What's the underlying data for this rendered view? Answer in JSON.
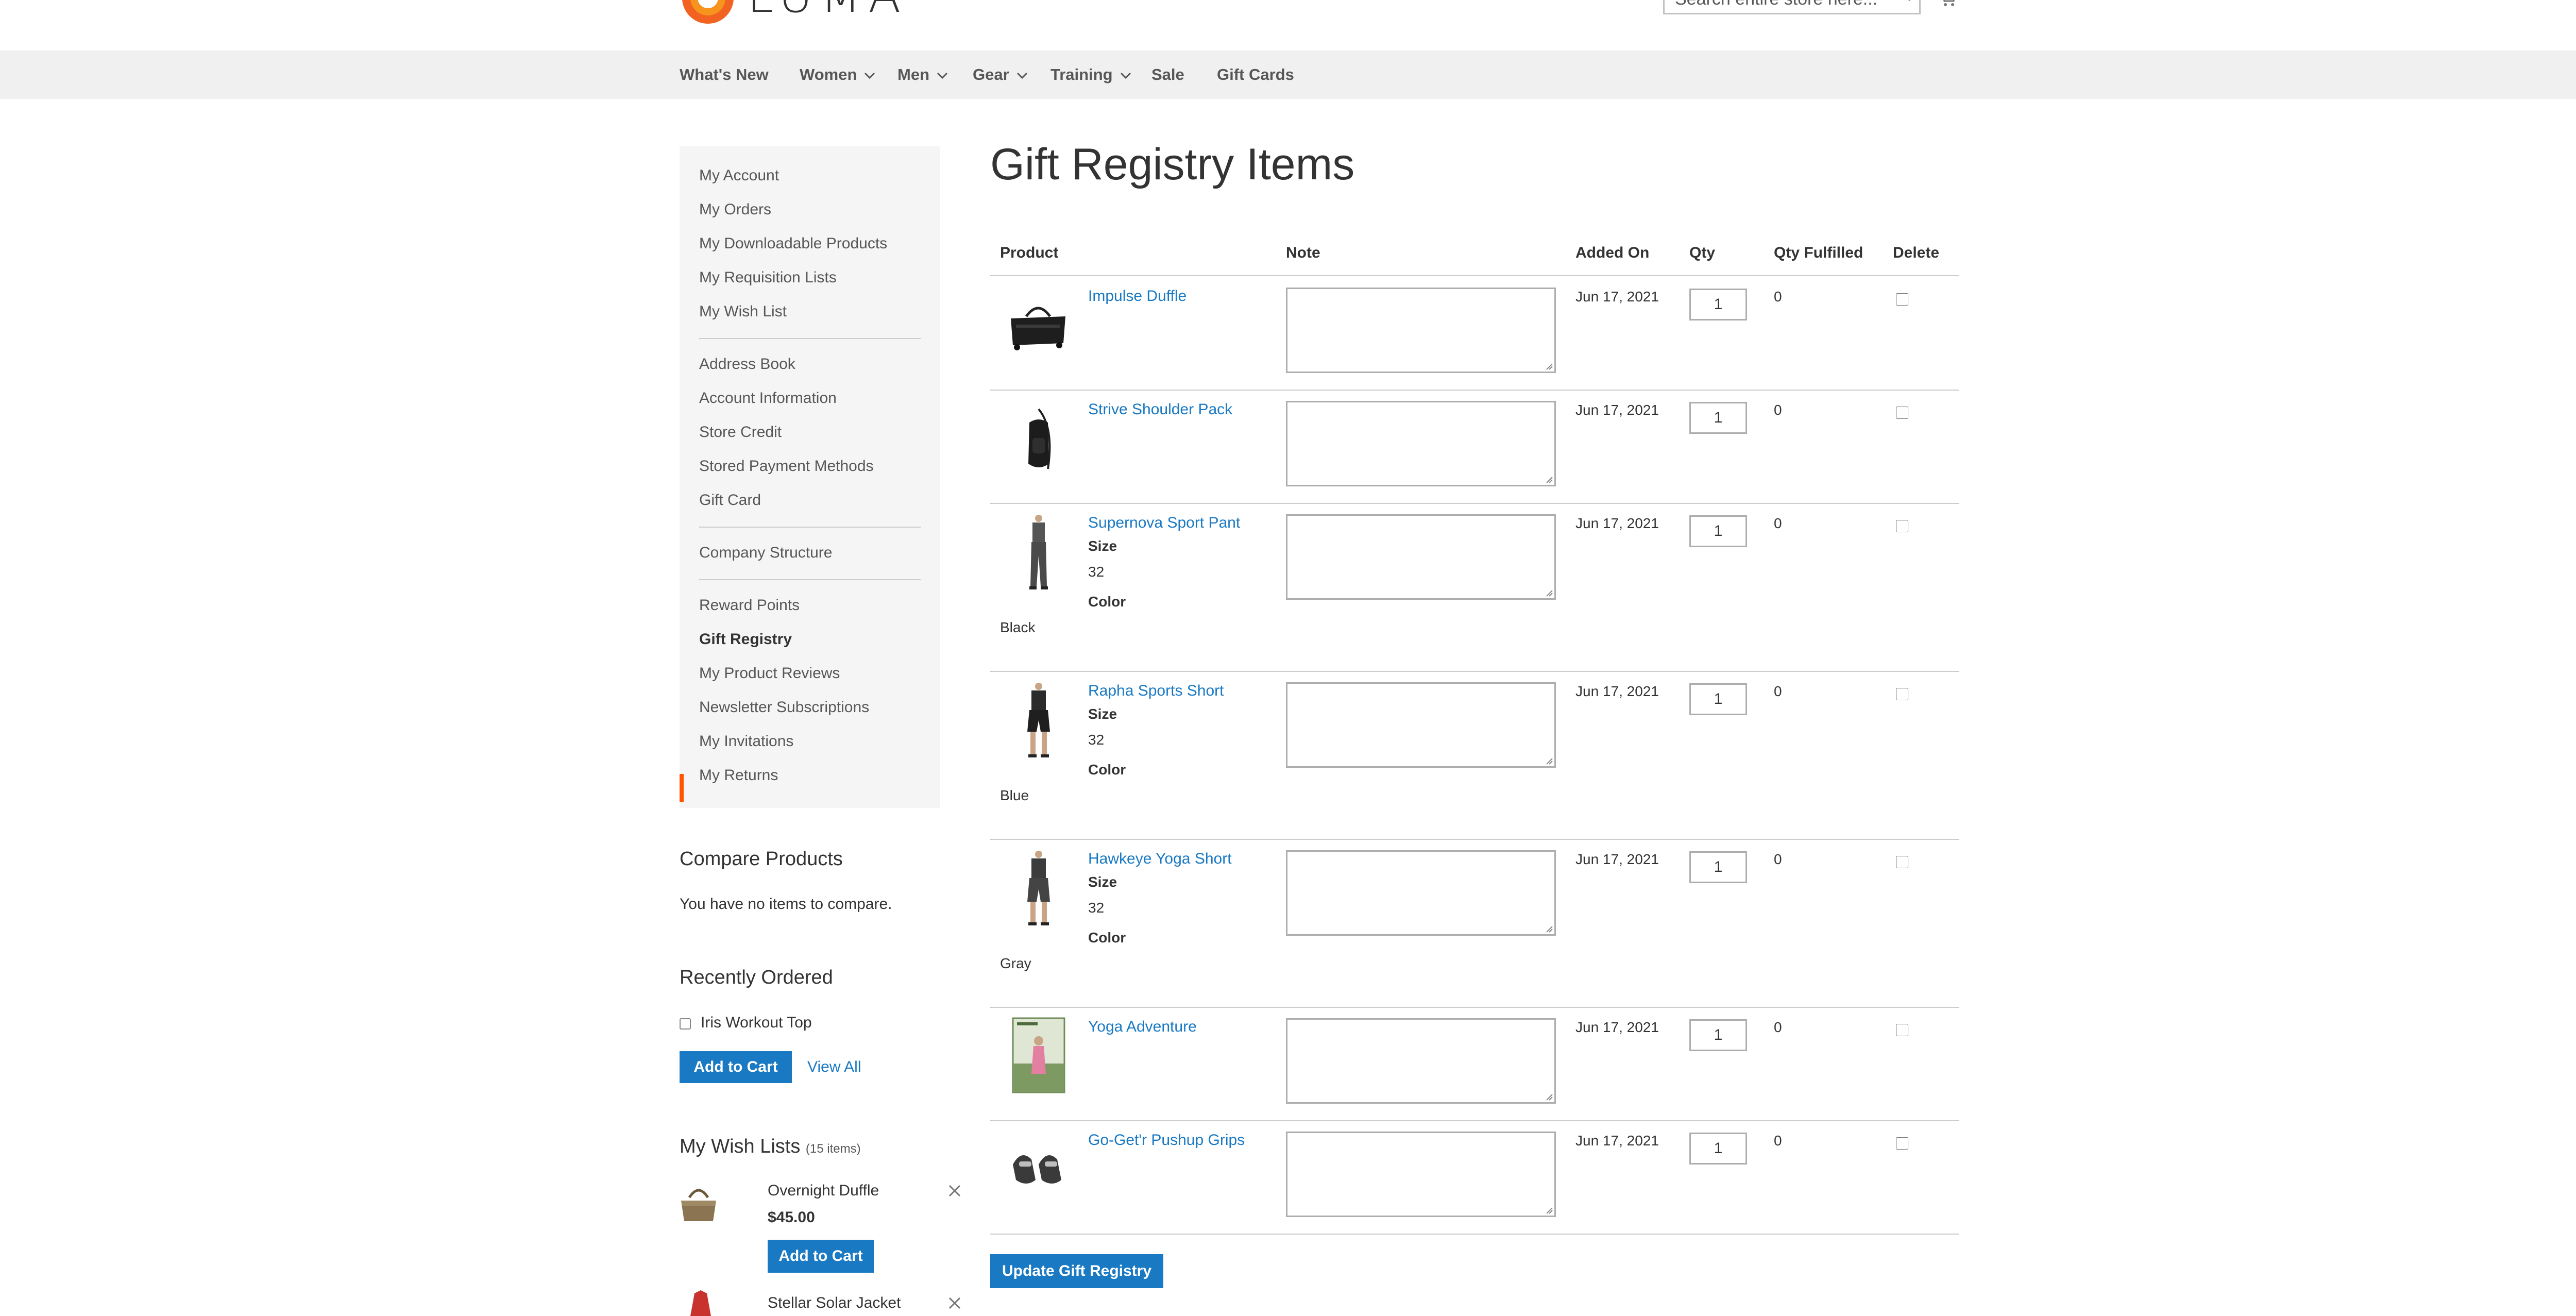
{
  "header": {
    "logo_text": "LUMA",
    "search": {
      "placeholder": "Search entire store here..."
    }
  },
  "nav": {
    "items": [
      {
        "label": "What's New",
        "has_dropdown": false
      },
      {
        "label": "Women",
        "has_dropdown": true
      },
      {
        "label": "Men",
        "has_dropdown": true
      },
      {
        "label": "Gear",
        "has_dropdown": true
      },
      {
        "label": "Training",
        "has_dropdown": true
      },
      {
        "label": "Sale",
        "has_dropdown": false
      },
      {
        "label": "Gift Cards",
        "has_dropdown": false
      }
    ]
  },
  "sidebar": {
    "items": [
      "My Account",
      "My Orders",
      "My Downloadable Products",
      "My Requisition Lists",
      "My Wish List",
      "Address Book",
      "Account Information",
      "Store Credit",
      "Stored Payment Methods",
      "Gift Card",
      "Company Structure",
      "Reward Points",
      "Gift Registry",
      "My Product Reviews",
      "Newsletter Subscriptions",
      "My Invitations",
      "My Returns"
    ],
    "active": "Gift Registry",
    "accent_color": "#ff5501"
  },
  "compare": {
    "title": "Compare Products",
    "empty_text": "You have no items to compare."
  },
  "recently_ordered": {
    "title": "Recently Ordered",
    "item": "Iris Workout Top",
    "add_to_cart": "Add to Cart",
    "view_all": "View All"
  },
  "wishlists": {
    "title": "My Wish Lists",
    "count": "(15 items)",
    "items": [
      {
        "name": "Overnight Duffle",
        "price": "$45.00",
        "button": "Add to Cart"
      },
      {
        "name": "Stellar Solar Jacket"
      }
    ]
  },
  "main": {
    "title": "Gift Registry Items",
    "columns": {
      "product": "Product",
      "note": "Note",
      "added_on": "Added On",
      "qty": "Qty",
      "qty_fulfilled": "Qty Fulfilled",
      "delete": "Delete"
    },
    "items": [
      {
        "name": "Impulse Duffle",
        "date": "Jun 17, 2021",
        "qty": "1",
        "fulfilled": "0"
      },
      {
        "name": "Strive Shoulder Pack",
        "date": "Jun 17, 2021",
        "qty": "1",
        "fulfilled": "0"
      },
      {
        "name": "Supernova Sport Pant",
        "size_label": "Size",
        "size": "32",
        "color_label": "Color",
        "color": "Black",
        "date": "Jun 17, 2021",
        "qty": "1",
        "fulfilled": "0"
      },
      {
        "name": "Rapha Sports Short",
        "size_label": "Size",
        "size": "32",
        "color_label": "Color",
        "color": "Blue",
        "date": "Jun 17, 2021",
        "qty": "1",
        "fulfilled": "0"
      },
      {
        "name": "Hawkeye Yoga Short",
        "size_label": "Size",
        "size": "32",
        "color_label": "Color",
        "color": "Gray",
        "date": "Jun 17, 2021",
        "qty": "1",
        "fulfilled": "0"
      },
      {
        "name": "Yoga Adventure",
        "date": "Jun 17, 2021",
        "qty": "1",
        "fulfilled": "0"
      },
      {
        "name": "Go-Get'r Pushup Grips",
        "date": "Jun 17, 2021",
        "qty": "1",
        "fulfilled": "0"
      }
    ],
    "update_button": "Update Gift Registry"
  },
  "colors": {
    "link": "#1979c3",
    "primary_button": "#1979c3",
    "nav_bg": "#f0f0f0",
    "sidebar_bg": "#f5f5f5"
  }
}
